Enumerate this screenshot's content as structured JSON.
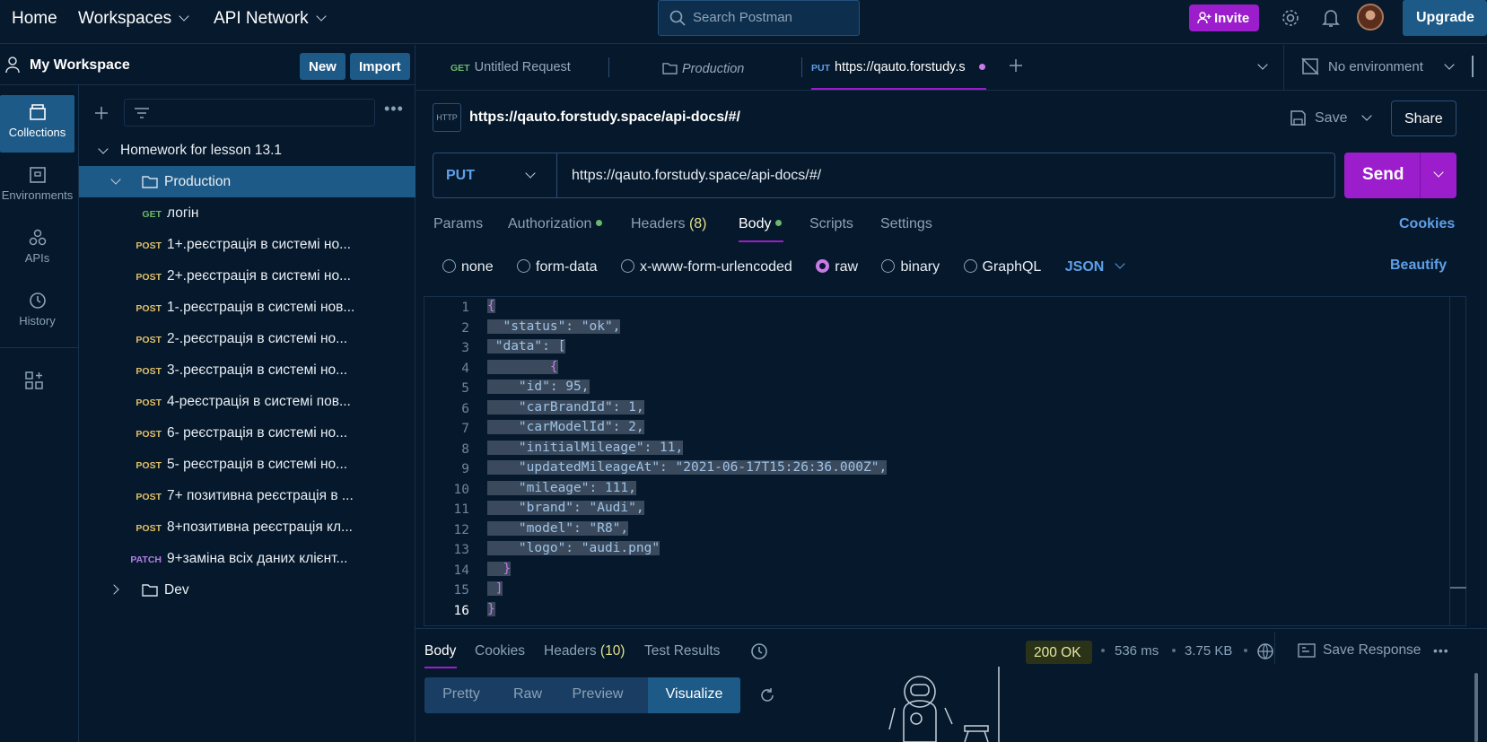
{
  "topbar": {
    "home": "Home",
    "workspaces": "Workspaces",
    "api_network": "API Network",
    "search_placeholder": "Search Postman",
    "invite": "Invite",
    "upgrade": "Upgrade"
  },
  "workspace": {
    "name": "My Workspace",
    "new": "New",
    "import": "Import"
  },
  "rail": [
    {
      "label": "Collections",
      "icon": "collections-icon"
    },
    {
      "label": "Environments",
      "icon": "environments-icon"
    },
    {
      "label": "APIs",
      "icon": "apis-icon"
    },
    {
      "label": "History",
      "icon": "history-icon"
    }
  ],
  "tree": {
    "collection": "Homework for lesson 13.1",
    "folder_production": "Production",
    "folder_dev": "Dev",
    "requests": [
      {
        "method": "GET",
        "name": "логін"
      },
      {
        "method": "POST",
        "name": "1+.реєстрація в системі но..."
      },
      {
        "method": "POST",
        "name": "2+.реєстрація в системі но..."
      },
      {
        "method": "POST",
        "name": "1-.реєстрація в системі нов..."
      },
      {
        "method": "POST",
        "name": "2-.реєстрація в системі но..."
      },
      {
        "method": "POST",
        "name": "3-.реєстрація в системі но..."
      },
      {
        "method": "POST",
        "name": "4-реєстрація в системі пов..."
      },
      {
        "method": "POST",
        "name": "6- реєстрація в системі но..."
      },
      {
        "method": "POST",
        "name": "5- реєстрація в системі но..."
      },
      {
        "method": "POST",
        "name": "7+ позитивна реєстрація в ..."
      },
      {
        "method": "POST",
        "name": "8+позитивна реєстрація кл..."
      },
      {
        "method": "PATCH",
        "name": "9+заміна всіх даних клієнт..."
      }
    ]
  },
  "tabs": {
    "tab1_method": "GET",
    "tab1_name": "Untitled Request",
    "tab2_name": "Production",
    "tab3_method": "PUT",
    "tab3_name": "https://qauto.forstudy.s",
    "environment": "No environment"
  },
  "request": {
    "title": "https://qauto.forstudy.space/api-docs/#/",
    "save": "Save",
    "share": "Share",
    "method": "PUT",
    "url": "https://qauto.forstudy.space/api-docs/#/",
    "send": "Send",
    "subtabs": {
      "params": "Params",
      "authorization": "Authorization",
      "headers": "Headers",
      "headers_count": "(8)",
      "body": "Body",
      "scripts": "Scripts",
      "settings": "Settings",
      "cookies": "Cookies"
    },
    "body_types": [
      "none",
      "form-data",
      "x-www-form-urlencoded",
      "raw",
      "binary",
      "GraphQL"
    ],
    "selected_body_type": "raw",
    "format": "JSON",
    "beautify": "Beautify"
  },
  "editor": {
    "lines": [
      "{",
      "  \"status\": \"ok\",",
      " \"data\": [",
      "        {",
      "    \"id\": 95,",
      "    \"carBrandId\": 1,",
      "    \"carModelId\": 2,",
      "    \"initialMileage\": 11,",
      "    \"updatedMileageAt\": \"2021-06-17T15:26:36.000Z\",",
      "    \"mileage\": 111,",
      "    \"brand\": \"Audi\",",
      "    \"model\": \"R8\",",
      "    \"logo\": \"audi.png\"",
      "  }",
      " ]",
      "}"
    ]
  },
  "response": {
    "body": "Body",
    "cookies": "Cookies",
    "headers": "Headers",
    "headers_count": "(10)",
    "test_results": "Test Results",
    "status": "200 OK",
    "time": "536 ms",
    "size": "3.75 KB",
    "save_response": "Save Response",
    "views": [
      "Pretty",
      "Raw",
      "Preview",
      "Visualize"
    ],
    "active_view": "Visualize"
  },
  "colors": {
    "background": "#06182b",
    "accent_purple": "#9b1dcb",
    "accent_blue": "#1e5a87",
    "status_ok": "#e6e6a0"
  }
}
